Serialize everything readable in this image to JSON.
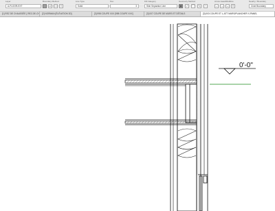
{
  "toolbar": {
    "layer": {
      "label": "Layer",
      "value": "A-FLOOR-EXT"
    },
    "boundary_method": {
      "label": "Boundary Method"
    },
    "line_type": {
      "label": "Line Type",
      "value": "Solid"
    },
    "pen": {
      "label": "Pen",
      "value": "3"
    },
    "fill_category": {
      "label": "Fill Category",
      "value": "Skin Separator Line"
    },
    "geometry_method": {
      "label": "Geometry Method"
    },
    "arrow_head": {
      "label": "Arrow Head/Multiline"
    },
    "nearby_boundary": {
      "label": "Nearby / Boundary",
      "value": "Zone Boundary"
    }
  },
  "tabs": [
    {
      "label": "[1] REZ DE CHAUSSÉE [ REZ-DE-CHAUSSÉE ]",
      "active": false
    },
    {
      "label": "[2] NORMAN [ÉLÉVATION 3D]",
      "active": false
    },
    {
      "label": "[3] 998 COUPE XXX [998 COUPE XXX]",
      "active": false
    },
    {
      "label": "[3] 007 COUPE DE MURS ET DÉTAILS",
      "active": false
    },
    {
      "label": "[3] 003 COUPE ET L-ATT MURS/PLANCHER X-PANEL",
      "active": true
    }
  ],
  "drawing": {
    "level_marker": "0'-0\""
  }
}
